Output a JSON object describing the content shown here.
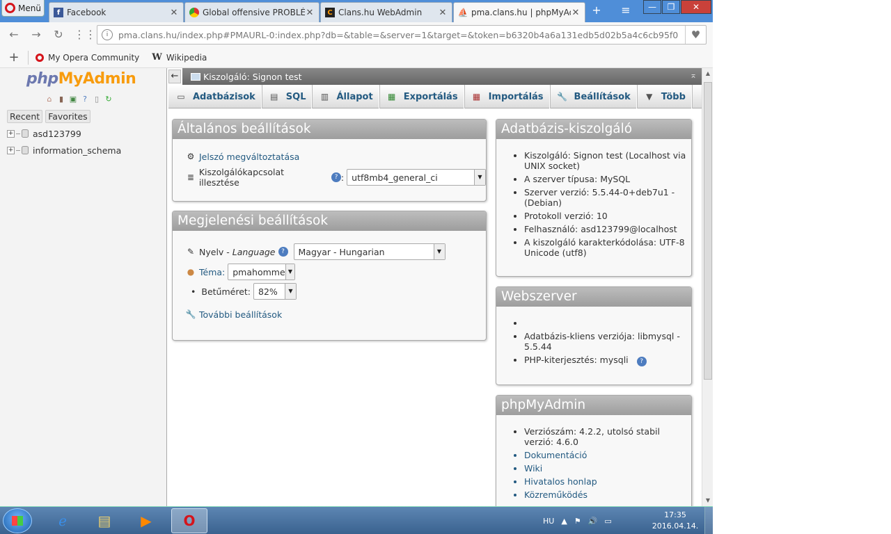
{
  "browser": {
    "menu_label": "Menü",
    "tabs": [
      {
        "label": "Facebook",
        "icon": "facebook-icon"
      },
      {
        "label": "Global offensive PROBLÉMA",
        "icon": "chrome-icon"
      },
      {
        "label": "Clans.hu WebAdmin",
        "icon": "clans-icon"
      },
      {
        "label": "pma.clans.hu | phpMyAdmin",
        "icon": "pma-icon"
      }
    ],
    "url": "pma.clans.hu/index.php#PMAURL-0:index.php?db=&table=&server=1&target=&token=b6320b4a6a131edb5d02b5a4c6cb95f0",
    "bookmarks": [
      "My Opera Community",
      "Wikipedia"
    ]
  },
  "nav": {
    "logo_php": "php",
    "logo_my": "My",
    "logo_admin": "Admin",
    "recent_label": "Recent",
    "favorites_label": "Favorites",
    "databases": [
      "asd123799",
      "information_schema"
    ]
  },
  "serverbar": {
    "title": "Kiszolgáló: Signon test"
  },
  "topmenu": [
    {
      "label": "Adatbázisok",
      "icon": "database-icon"
    },
    {
      "label": "SQL",
      "icon": "sql-icon"
    },
    {
      "label": "Állapot",
      "icon": "status-icon"
    },
    {
      "label": "Exportálás",
      "icon": "export-icon"
    },
    {
      "label": "Importálás",
      "icon": "import-icon"
    },
    {
      "label": "Beállítások",
      "icon": "wrench-icon"
    },
    {
      "label": "Több",
      "icon": "more-icon"
    }
  ],
  "general": {
    "title": "Általános beállítások",
    "change_password": "Jelszó megváltoztatása",
    "collation_label": "Kiszolgálókapcsolat illesztése",
    "collation_value": "utf8mb4_general_ci"
  },
  "appearance": {
    "title": "Megjelenési beállítások",
    "language_label": "Nyelv - ",
    "language_italic": "Language",
    "language_value": "Magyar - Hungarian",
    "theme_label": "Téma:",
    "theme_value": "pmahomme",
    "fontsize_label": "Betűméret:",
    "fontsize_value": "82%",
    "more_settings": "További beállítások"
  },
  "db_server": {
    "title": "Adatbázis-kiszolgáló",
    "items": [
      "Kiszolgáló: Signon test (Localhost via UNIX socket)",
      "A szerver típusa: MySQL",
      "Szerver verzió: 5.5.44-0+deb7u1 - (Debian)",
      "Protokoll verzió: 10",
      "Felhasználó: asd123799@localhost",
      "A kiszolgáló karakterkódolása: UTF-8 Unicode (utf8)"
    ]
  },
  "webserver": {
    "title": "Webszerver",
    "items": [
      "",
      "Adatbázis-kliens verziója: libmysql - 5.5.44",
      "PHP-kiterjesztés: mysqli"
    ]
  },
  "pma": {
    "title": "phpMyAdmin",
    "version": "Verziószám: 4.2.2, utolsó stabil verzió: 4.6.0",
    "links": [
      "Dokumentáció",
      "Wiki",
      "Hivatalos honlap",
      "Közreműködés"
    ]
  },
  "taskbar": {
    "lang": "HU",
    "time": "17:35",
    "date": "2016.04.14."
  }
}
